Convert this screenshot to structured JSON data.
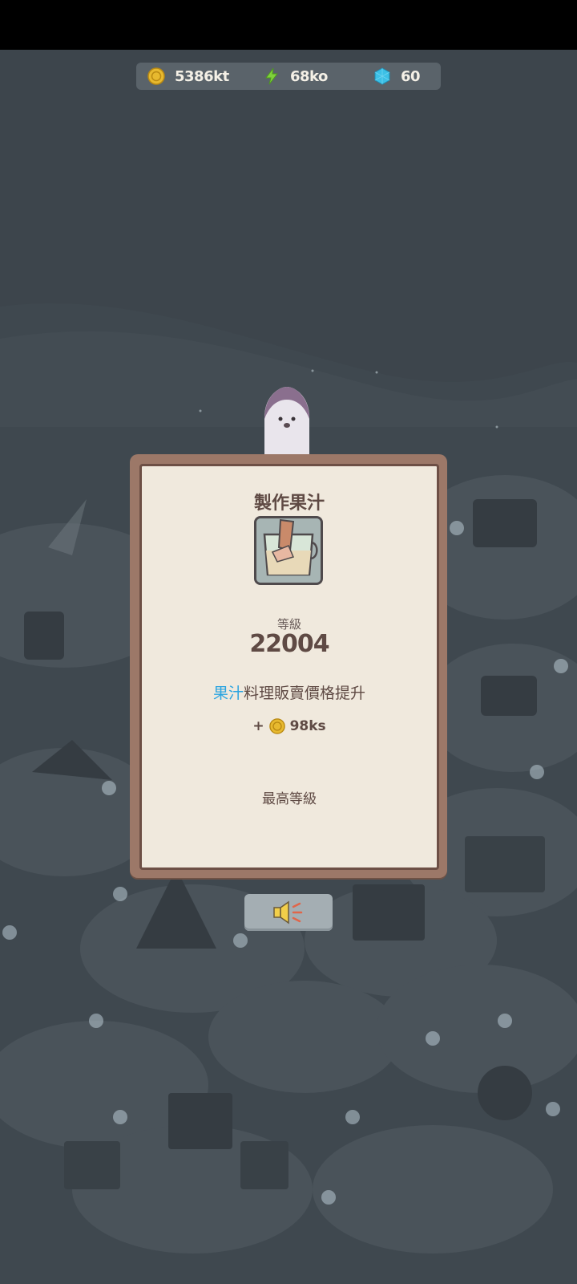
{
  "resources": {
    "coins": "5386kt",
    "energy": "68ko",
    "gems": "60"
  },
  "dialog": {
    "title": "製作果汁",
    "level_label": "等級",
    "level_value": "22004",
    "description_highlight": "果汁",
    "description_rest": "料理販賣價格提升",
    "reward_prefix": "+",
    "reward_value": "98ks",
    "max_level_text": "最高等級"
  },
  "icons": {
    "coin": "coin-icon",
    "energy": "lightning-icon",
    "gem": "gem-icon",
    "item": "juice-cup-icon",
    "sound": "speaker-icon"
  },
  "colors": {
    "highlight": "#2aa4e0",
    "dialog_bg": "#f0e9dd",
    "dialog_frame": "#9c7868",
    "text": "#5f4a44",
    "scene_bg": "#3f484f"
  }
}
